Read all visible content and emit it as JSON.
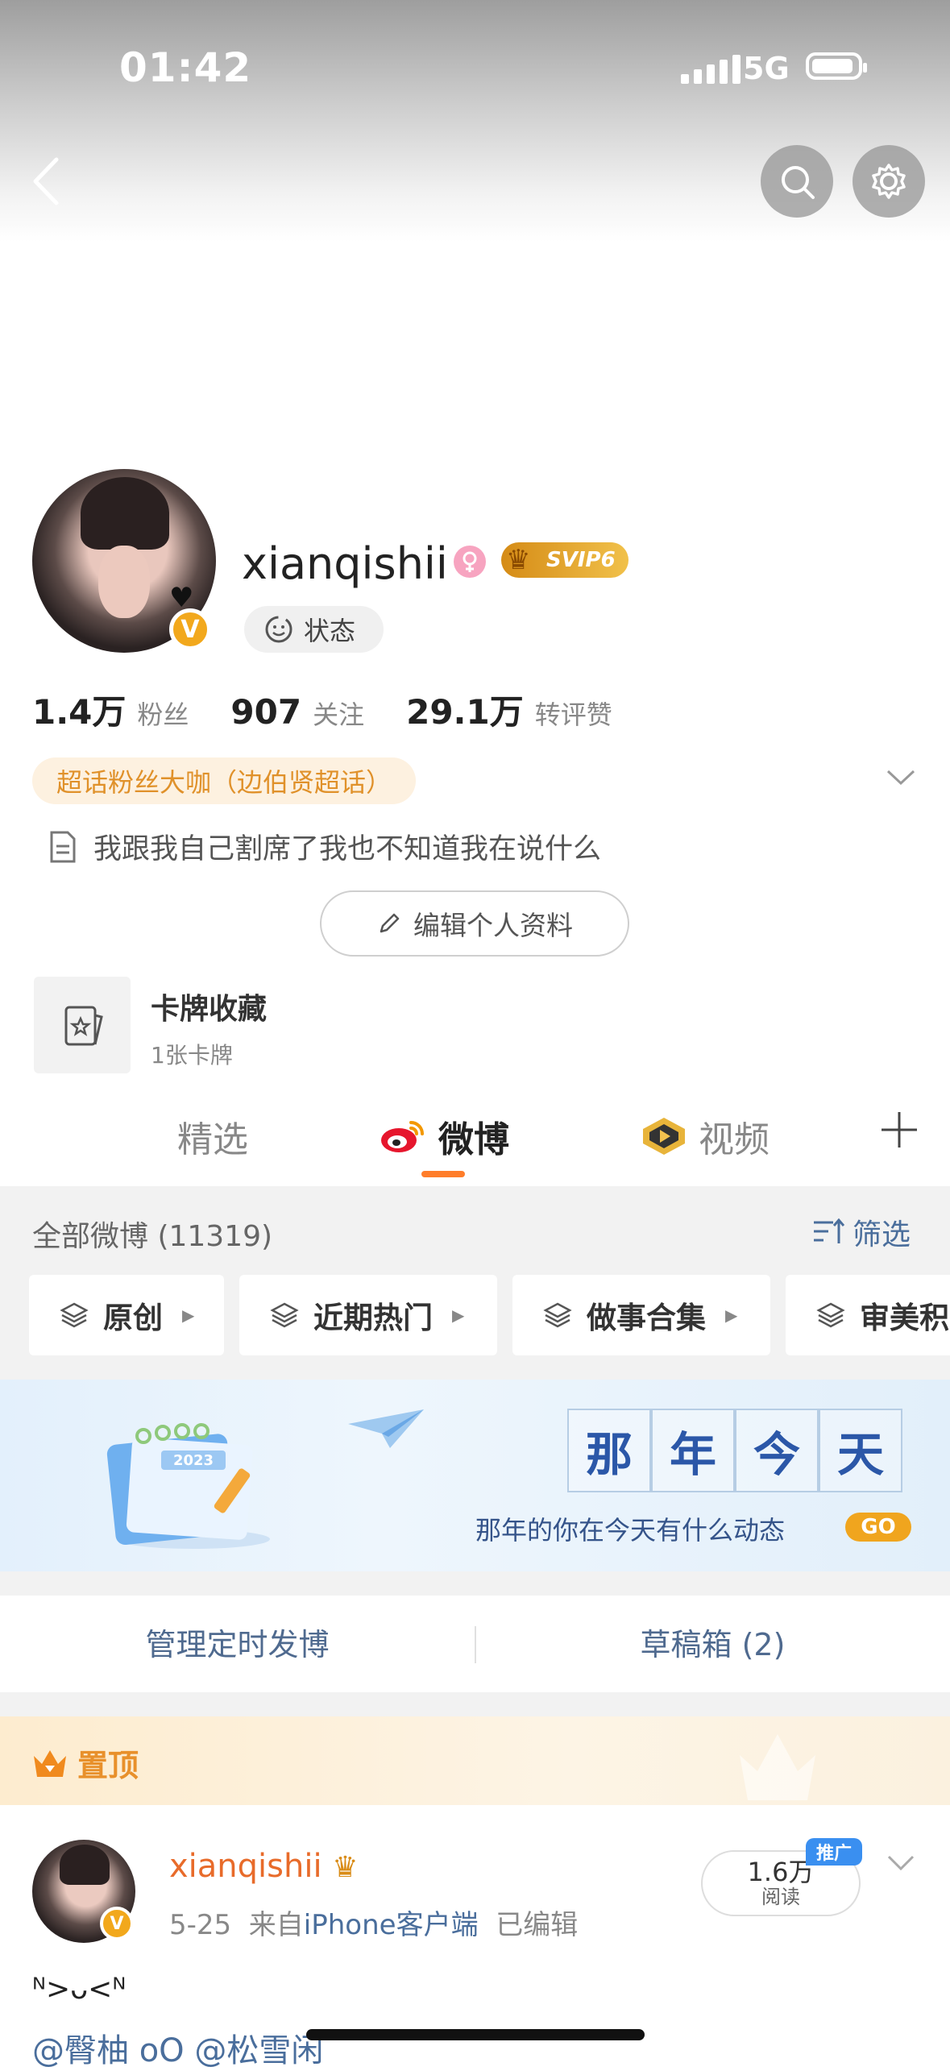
{
  "status_bar": {
    "time": "01:42",
    "network": "5G"
  },
  "profile": {
    "username": "xianqishii",
    "vip_label": "SVIP6",
    "status_chip": "状态",
    "stats": [
      {
        "value": "1.4万",
        "label": "粉丝"
      },
      {
        "value": "907",
        "label": "关注"
      },
      {
        "value": "29.1万",
        "label": "转评赞"
      }
    ],
    "fan_badge": "超话粉丝大咖（边伯贤超话）",
    "bio": "我跟我自己割席了我也不知道我在说什么",
    "edit_button": "编辑个人资料",
    "card": {
      "title": "卡牌收藏",
      "subtitle": "1张卡牌"
    }
  },
  "tabs": [
    {
      "label": "精选",
      "active": false
    },
    {
      "label": "微博",
      "active": true
    },
    {
      "label": "视频",
      "active": false
    }
  ],
  "feed": {
    "all_label": "全部微博 (11319)",
    "filter_label": "筛选",
    "chips": [
      "原创",
      "近期热门",
      "做事合集",
      "审美积"
    ]
  },
  "banner": {
    "calendar_year": "2023",
    "title_chars": [
      "那",
      "年",
      "今",
      "天"
    ],
    "subtitle": "那年的你在今天有什么动态",
    "go_label": "GO"
  },
  "manage": {
    "scheduled": "管理定时发博",
    "drafts": "草稿箱 (2)"
  },
  "post": {
    "pinned_label": "置顶",
    "username": "xianqishii",
    "date": "5-25",
    "from_prefix": "来自",
    "source": "iPhone客户端",
    "edited": "已编辑",
    "views_value": "1.6万",
    "views_label": "阅读",
    "promo_label": "推广",
    "text": "ᴺ>ᴗ<ᴺ",
    "mentions": "@臀柚 oO @松雪闲"
  },
  "colors": {
    "accent": "#ff7d2a",
    "link": "#4a6e9c",
    "fan_badge_text": "#e0912a",
    "vip_gold": "#f2a81c"
  },
  "icons": [
    "back-icon",
    "search-icon",
    "gear-icon",
    "female-icon",
    "crown-icon",
    "status-face-icon",
    "doc-icon",
    "pencil-icon",
    "card-icon",
    "weibo-logo-icon",
    "video-play-icon",
    "plus-icon",
    "filter-icon",
    "layers-icon",
    "chevron-down-icon"
  ]
}
